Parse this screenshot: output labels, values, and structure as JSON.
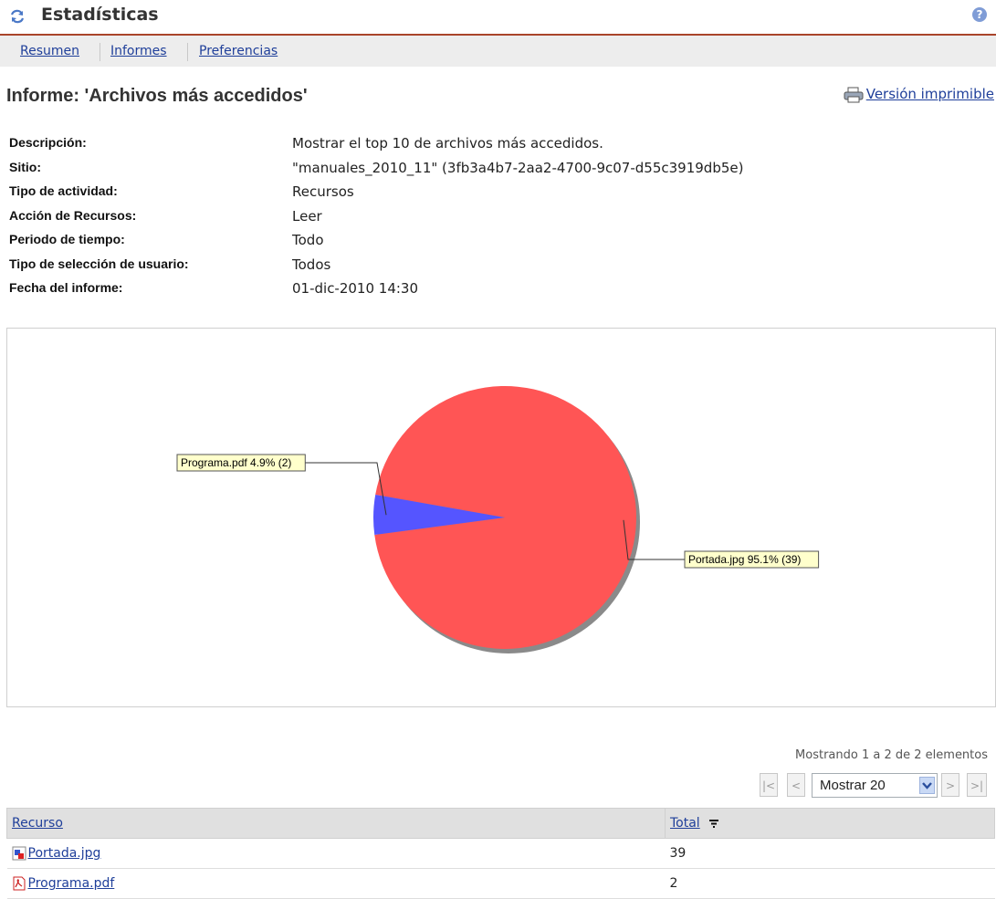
{
  "header": {
    "title": "Estadísticas",
    "help_icon": "?"
  },
  "nav": {
    "items": [
      "Resumen",
      "Informes",
      "Preferencias"
    ]
  },
  "report": {
    "title": "Informe: 'Archivos más accedidos'",
    "print_label": "Versión imprimible"
  },
  "details": [
    {
      "label": "Descripción:",
      "value": "Mostrar el top 10 de archivos más accedidos."
    },
    {
      "label": "Sitio:",
      "value": "\"manuales_2010_11\" (3fb3a4b7-2aa2-4700-9c07-d55c3919db5e)"
    },
    {
      "label": "Tipo de actividad:",
      "value": "Recursos"
    },
    {
      "label": "Acción de Recursos:",
      "value": "Leer"
    },
    {
      "label": "Periodo de tiempo:",
      "value": "Todo"
    },
    {
      "label": "Tipo de selección de usuario:",
      "value": "Todos"
    },
    {
      "label": "Fecha del informe:",
      "value": "01-dic-2010 14:30"
    }
  ],
  "chart_data": {
    "type": "pie",
    "slices": [
      {
        "name": "Portada.jpg",
        "value": 39,
        "percent": 95.1,
        "color": "#ff5555",
        "label": "Portada.jpg 95.1% (39)"
      },
      {
        "name": "Programa.pdf",
        "value": 2,
        "percent": 4.9,
        "color": "#5555ff",
        "label": "Programa.pdf 4.9% (2)"
      }
    ]
  },
  "paging": {
    "status": "Mostrando 1 a 2 de 2 elementos",
    "page_size": "Mostrar 20",
    "first": "|<",
    "prev": "<",
    "next": ">",
    "last": ">|"
  },
  "table": {
    "columns": [
      "Recurso",
      "Total"
    ],
    "rows": [
      {
        "resource": "Portada.jpg",
        "total": "39",
        "icon": "image-file-icon"
      },
      {
        "resource": "Programa.pdf",
        "total": "2",
        "icon": "pdf-file-icon"
      }
    ]
  },
  "colors": {
    "header_rule": "#a9442a",
    "link": "#1f3f9a",
    "nav_bg": "#ededed",
    "label_bg": "#ffffcc"
  }
}
